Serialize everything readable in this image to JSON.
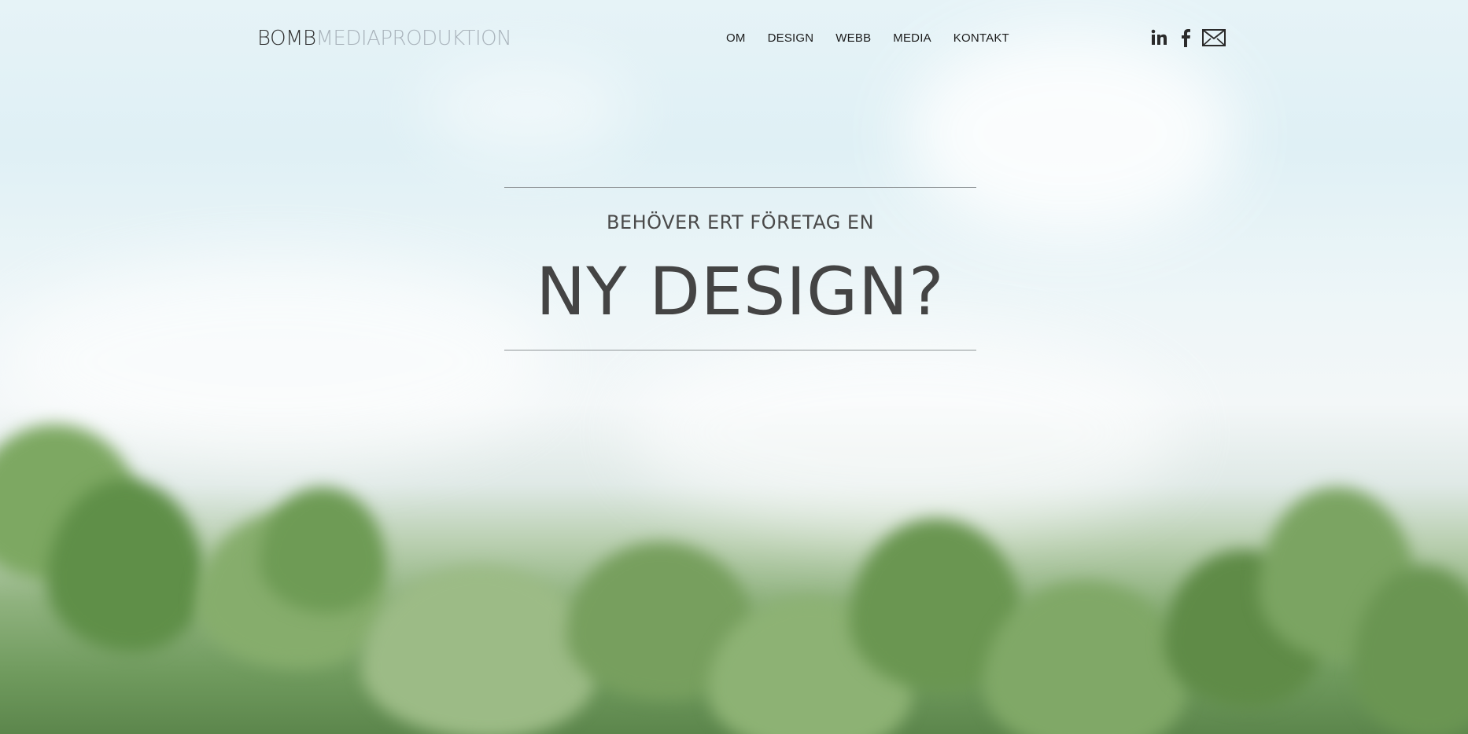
{
  "logo": {
    "brand": "BOMB",
    "sub": "MEDIAPRODUKTION"
  },
  "nav": [
    {
      "label": "OM"
    },
    {
      "label": "DESIGN"
    },
    {
      "label": "WEBB"
    },
    {
      "label": "MEDIA"
    },
    {
      "label": "KONTAKT"
    }
  ],
  "social": [
    {
      "icon": "linkedin-icon"
    },
    {
      "icon": "facebook-icon"
    },
    {
      "icon": "mail-icon"
    }
  ],
  "hero": {
    "kicker": "BEHÖVER ERT FÖRETAG EN",
    "headline": "NY DESIGN?"
  },
  "colors": {
    "text_dark": "#444444",
    "nav_text": "#1b1b1b",
    "logo_light": "#a9b3bb",
    "rule": "#8f9597"
  }
}
